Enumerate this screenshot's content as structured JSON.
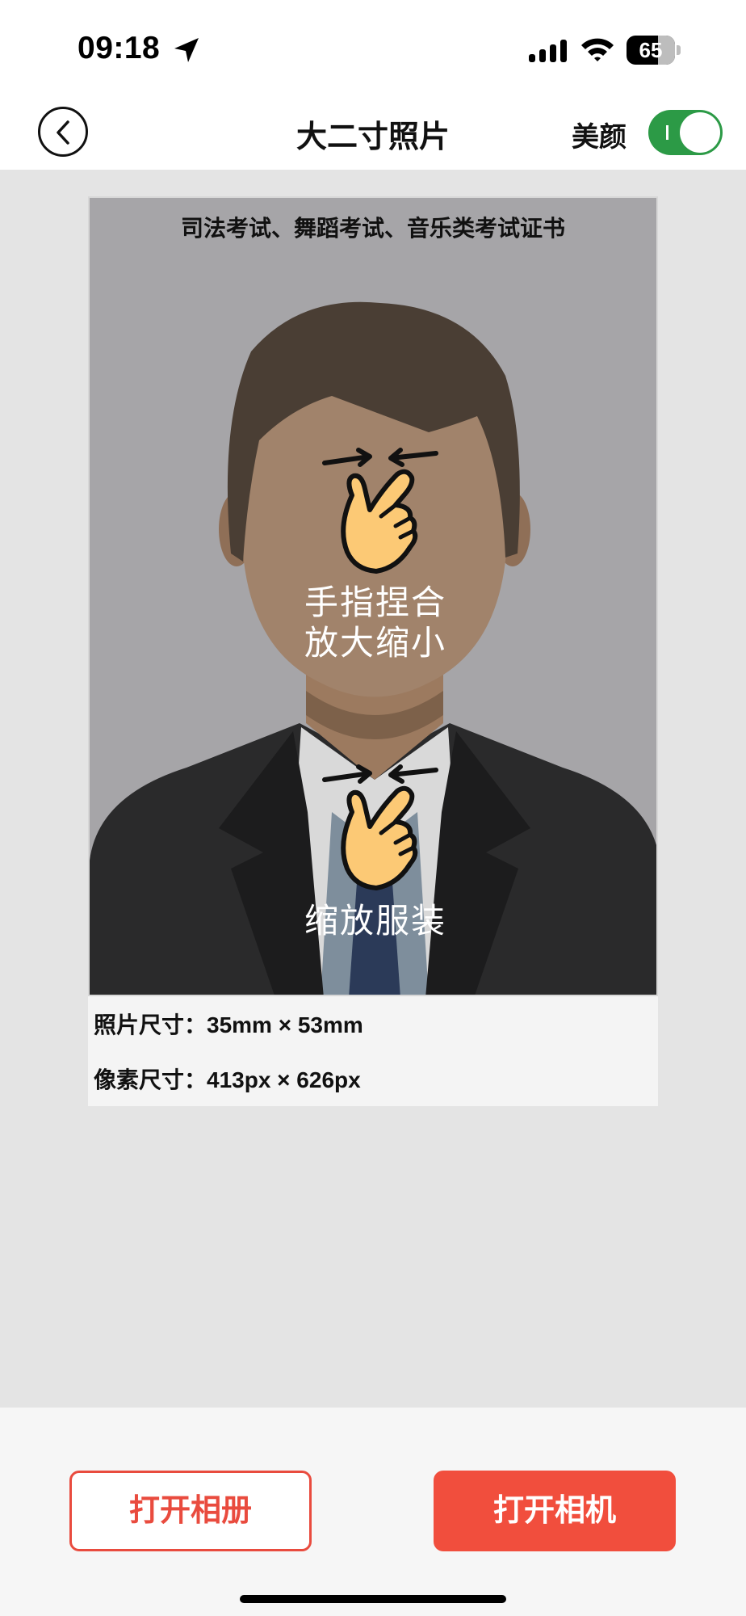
{
  "status_bar": {
    "time": "09:18",
    "battery": "65",
    "location_icon": "location-arrow-icon",
    "signal_icon": "cellular-signal-icon",
    "wifi_icon": "wifi-icon"
  },
  "nav": {
    "title": "大二寸照片",
    "beauty_label": "美颜",
    "beauty_on": true,
    "back_icon": "chevron-left-icon"
  },
  "photo": {
    "caption": "司法考试、舞蹈考试、音乐类考试证书",
    "gesture_zoom": "手指捏合\n放大缩小",
    "gesture_clothing": "缩放服装",
    "gesture_icon": "pinch-hand-icon"
  },
  "info": {
    "photo_size": "照片尺寸：35mm × 53mm",
    "pixel_size": "像素尺寸：413px × 626px"
  },
  "actions": {
    "open_album": "打开相册",
    "open_camera": "打开相机"
  },
  "colors": {
    "accent": "#f14e3d",
    "toggle_on": "#2c9a46",
    "canvas_bg": "#e4e4e4",
    "photo_bg": "#a6a5a8"
  }
}
